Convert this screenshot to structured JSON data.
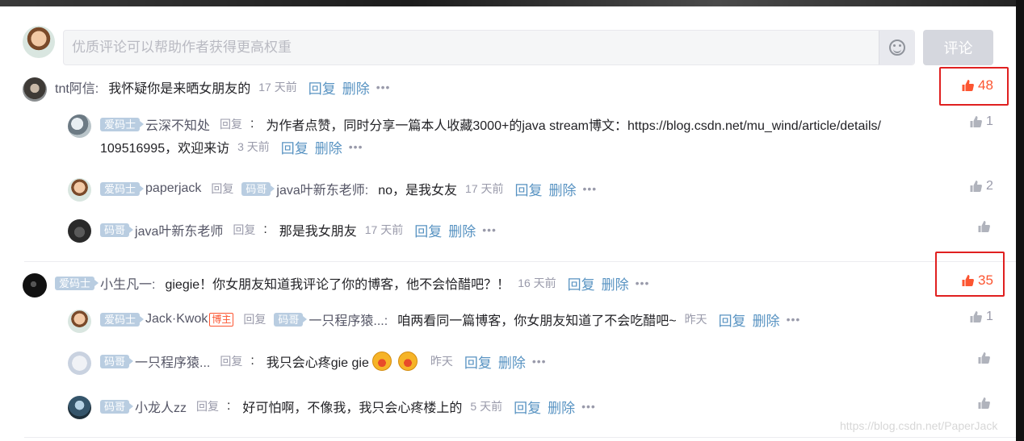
{
  "composer": {
    "placeholder": "优质评论可以帮助作者获得更高权重",
    "submit_label": "评论"
  },
  "labels": {
    "reply": "回复",
    "delete": "删除",
    "replied": "回复",
    "dots": "•••"
  },
  "threads": [
    {
      "author": "tnt阿信:",
      "text": "我怀疑你是来晒女朋友的",
      "time": "17 天前",
      "likes": "48",
      "replies": [
        {
          "badge": "爱码士",
          "author": "云深不知处",
          "text_line1": "为作者点赞，同时分享一篇本人收藏3000+的java stream博文：https://blog.csdn.net/mu_wind/article/details/",
          "text_line2": "109516995，欢迎来访",
          "time": "3 天前",
          "likes": "1"
        },
        {
          "badge": "爱码士",
          "author": "paperjack",
          "to_badge": "码哥",
          "to": "java叶新东老师:",
          "text": "no，是我女友",
          "time": "17 天前",
          "likes": "2"
        },
        {
          "badge": "码哥",
          "author": "java叶新东老师",
          "text": "那是我女朋友",
          "time": "17 天前",
          "likes": ""
        }
      ]
    },
    {
      "badge": "爱码士",
      "author": "小生凡一:",
      "text": "giegie！你女朋友知道我评论了你的博客，他不会恰醋吧？！",
      "time": "16 天前",
      "likes": "35",
      "replies": [
        {
          "badge": "爱码士",
          "author": "Jack·Kwok",
          "tag": "博主",
          "to_badge": "码哥",
          "to": "一只程序猿...:",
          "text": "咱两看同一篇博客，你女朋友知道了不会吃醋吧~",
          "time": "昨天",
          "likes": "1"
        },
        {
          "badge": "码哥",
          "author": "一只程序猿...",
          "text": "我只会心疼gie gie",
          "time": "昨天",
          "likes": ""
        },
        {
          "badge": "码哥",
          "author": "小龙人zz",
          "text": "好可怕啊，不像我，我只会心疼楼上的",
          "time": "5 天前",
          "likes": ""
        }
      ]
    }
  ],
  "watermark": "https://blog.csdn.net/PaperJack"
}
